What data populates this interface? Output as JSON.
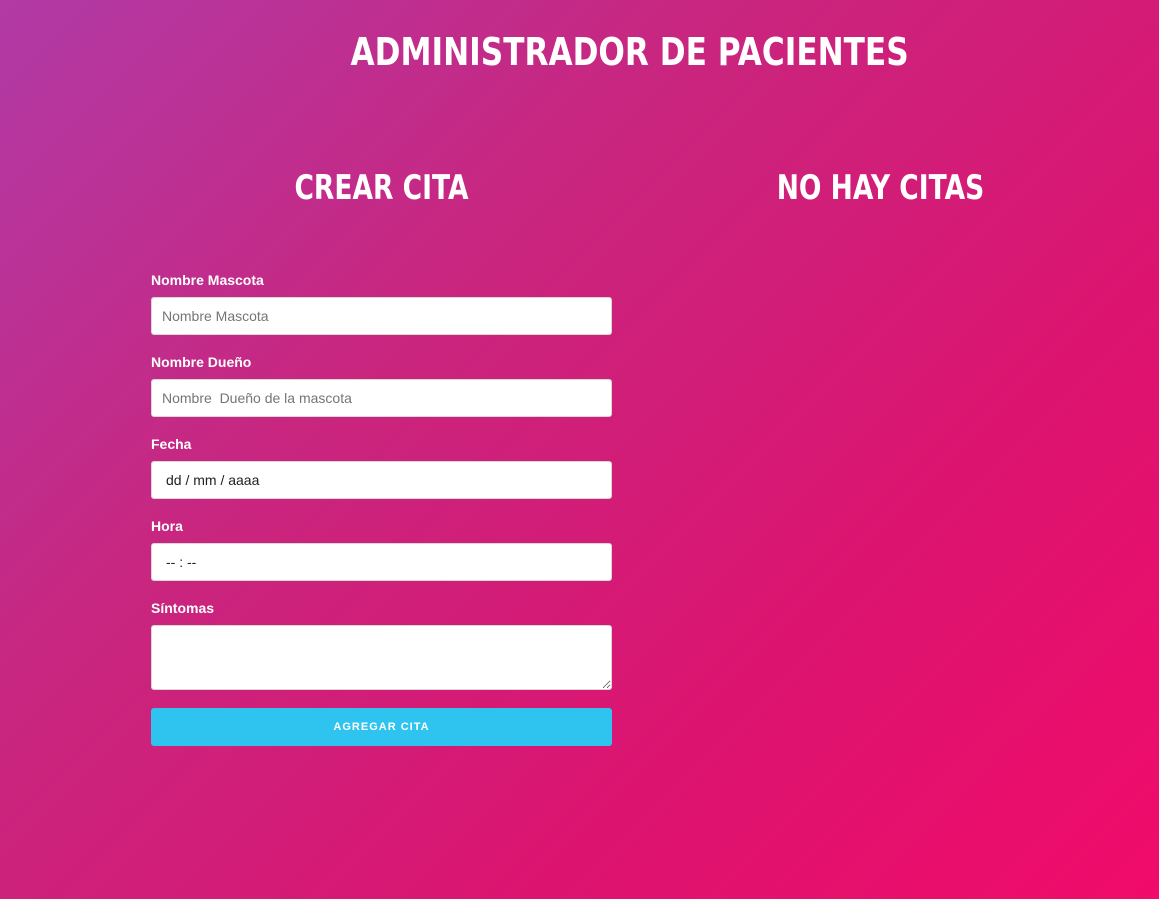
{
  "header": {
    "title": "ADMINISTRADOR DE PACIENTES"
  },
  "create_section": {
    "title": "CREAR CITA"
  },
  "list_section": {
    "title": "NO HAY CITAS"
  },
  "form": {
    "pet_name": {
      "label": "Nombre Mascota",
      "placeholder": "Nombre Mascota",
      "value": ""
    },
    "owner_name": {
      "label": "Nombre Dueño",
      "placeholder": "Nombre  Dueño de la mascota",
      "value": ""
    },
    "date": {
      "label": "Fecha",
      "display": "dd / mm / aaaa"
    },
    "time": {
      "label": "Hora",
      "display": "-- : --"
    },
    "symptoms": {
      "label": "Síntomas",
      "value": ""
    },
    "submit_label": "AGREGAR CITA"
  },
  "colors": {
    "gradient_start": "#b13aa6",
    "gradient_end": "#f10b6a",
    "button": "#2fc3ef"
  }
}
